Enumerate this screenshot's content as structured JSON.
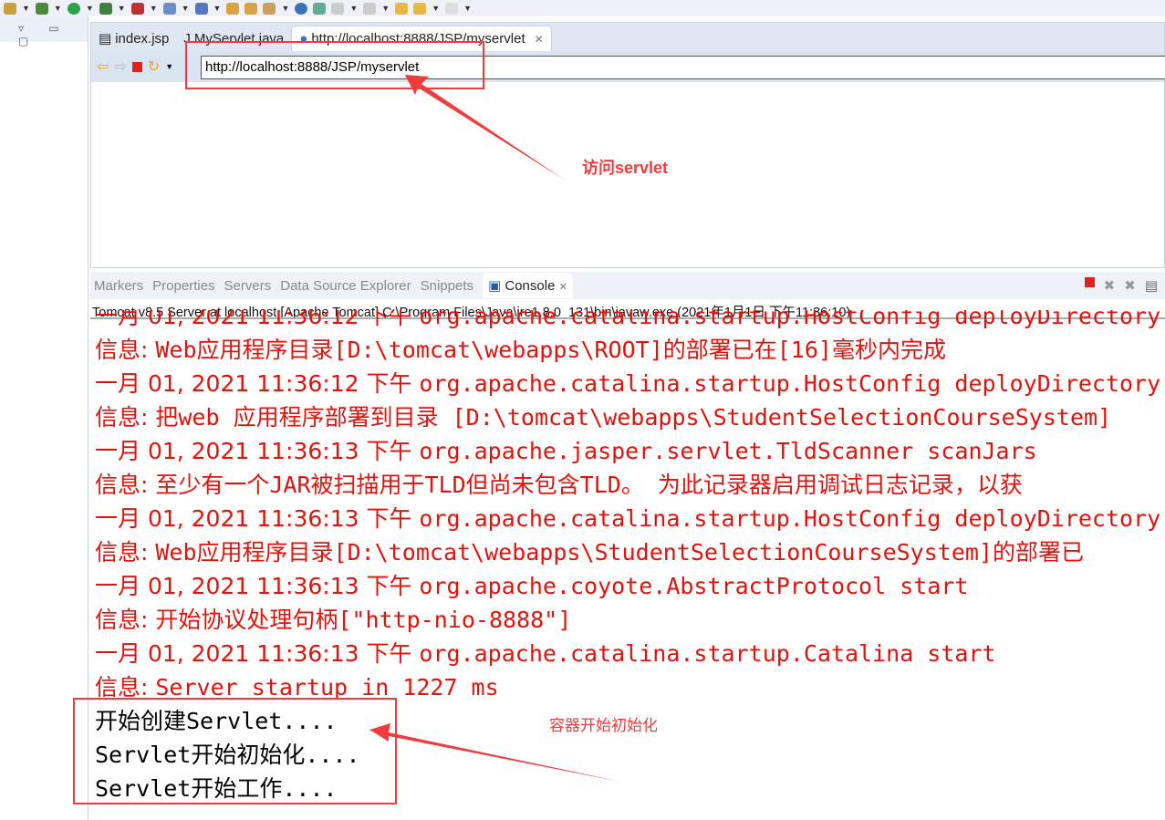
{
  "editor": {
    "tabs": [
      {
        "label": "index.jsp",
        "icon": "jsp-file-icon"
      },
      {
        "label": "MyServlet.java",
        "icon": "java-file-icon"
      },
      {
        "label": "http://localhost:8888/JSP/myservlet",
        "icon": "globe-icon",
        "active": true
      }
    ],
    "url": "http://localhost:8888/JSP/myservlet"
  },
  "views": {
    "tabs": [
      {
        "label": "Markers"
      },
      {
        "label": "Properties"
      },
      {
        "label": "Servers"
      },
      {
        "label": "Data Source Explorer"
      },
      {
        "label": "Snippets"
      },
      {
        "label": "Console",
        "active": true
      }
    ],
    "process": "Tomcat v8.5 Server at localhost [Apache Tomcat] C:\\Program Files\\Java\\jre1.8.0_131\\bin\\javaw.exe (2021年1月1日 下午11:36:10)"
  },
  "console": {
    "lines": [
      {
        "p": "一月 01, 2021 11:36:12 下午 ",
        "m": "org.apache.catalina.startup.HostConfig deployDirectory"
      },
      {
        "p": "信息: ",
        "m": "Web应用程序目录[D:\\tomcat\\webapps\\ROOT]的部署已在[16]毫秒内完成"
      },
      {
        "p": "一月 01, 2021 11:36:12 下午 ",
        "m": "org.apache.catalina.startup.HostConfig deployDirectory"
      },
      {
        "p": "信息: ",
        "m": "把web 应用程序部署到目录 [D:\\tomcat\\webapps\\StudentSelectionCourseSystem]"
      },
      {
        "p": "一月 01, 2021 11:36:13 下午 ",
        "m": "org.apache.jasper.servlet.TldScanner scanJars"
      },
      {
        "p": "信息: ",
        "m": "至少有一个JAR被扫描用于TLD但尚未包含TLD。 为此记录器启用调试日志记录，以获"
      },
      {
        "p": "一月 01, 2021 11:36:13 下午 ",
        "m": "org.apache.catalina.startup.HostConfig deployDirectory"
      },
      {
        "p": "信息: ",
        "m": "Web应用程序目录[D:\\tomcat\\webapps\\StudentSelectionCourseSystem]的部署已"
      },
      {
        "p": "一月 01, 2021 11:36:13 下午 ",
        "m": "org.apache.coyote.AbstractProtocol start"
      },
      {
        "p": "信息: ",
        "m": "开始协议处理句柄[\"http-nio-8888\"]"
      },
      {
        "p": "一月 01, 2021 11:36:13 下午 ",
        "m": "org.apache.catalina.startup.Catalina start"
      },
      {
        "p": "信息: ",
        "m": "Server startup in 1227 ms"
      }
    ],
    "output": [
      "开始创建Servlet....",
      "Servlet开始初始化....",
      "Servlet开始工作...."
    ]
  },
  "annotations": {
    "url_note": "访问servlet",
    "init_note": "容器开始初始化",
    "color": "#f03c3c"
  }
}
